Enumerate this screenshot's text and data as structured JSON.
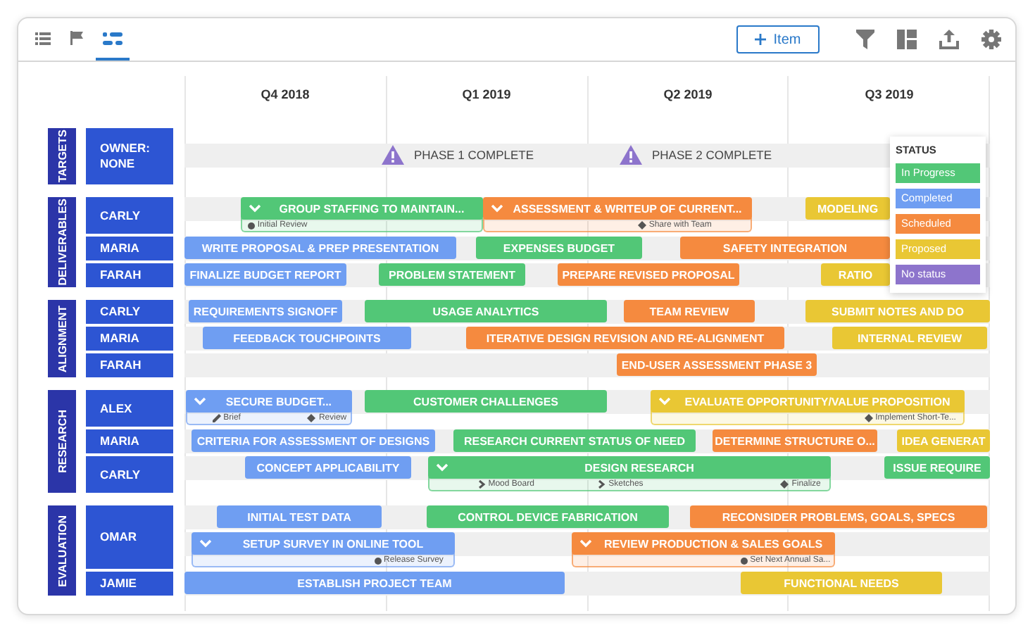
{
  "toolbar": {
    "views": [
      {
        "selected": false
      },
      {
        "selected": false
      },
      {
        "selected": true
      }
    ],
    "add_button": {
      "label": "Item"
    }
  },
  "quarters": [
    "Q4 2018",
    "Q1 2019",
    "Q2 2019",
    "Q3 2019"
  ],
  "legend": {
    "title": "STATUS",
    "items": [
      {
        "label": "In Progress",
        "color": "#52c777"
      },
      {
        "label": "Completed",
        "color": "#6f9ef2"
      },
      {
        "label": "Scheduled",
        "color": "#f58a3f"
      },
      {
        "label": "Proposed",
        "color": "#e9c734"
      },
      {
        "label": "No status",
        "color": "#8d74cc"
      }
    ]
  },
  "groups": [
    {
      "label": "TARGETS",
      "lanes": [
        {
          "owner": "OWNER: NONE",
          "tracks": [
            {
              "milestones": [
                {
                  "label": "PHASE 1 COMPLETE"
                },
                {
                  "label": "PHASE 2 COMPLETE"
                }
              ]
            }
          ]
        }
      ]
    },
    {
      "label": "DELIVERABLES",
      "lanes": [
        {
          "owner": "CARLY",
          "tracks": [
            {
              "bars": [
                {
                  "label": "GROUP STAFFING TO MAINTAIN...",
                  "color": "#52c777",
                  "expanded": true,
                  "subitems": [
                    {
                      "kind": "dot",
                      "label": "Initial Review"
                    }
                  ]
                },
                {
                  "label": "ASSESSMENT & WRITEUP OF CURRENT...",
                  "color": "#f58a3f",
                  "expanded": true,
                  "subitems": [
                    {
                      "kind": "diamond",
                      "label": "Share with Team"
                    }
                  ]
                },
                {
                  "label": "MODELING",
                  "color": "#e9c734",
                  "expanded": false
                }
              ]
            }
          ]
        },
        {
          "owner": "MARIA",
          "tracks": [
            {
              "bars": [
                {
                  "label": "WRITE PROPOSAL & PREP PRESENTATION",
                  "color": "#6f9ef2",
                  "expanded": false
                },
                {
                  "label": "EXPENSES BUDGET",
                  "color": "#52c777",
                  "expanded": false
                },
                {
                  "label": "SAFETY INTEGRATION",
                  "color": "#f58a3f",
                  "expanded": false
                }
              ]
            }
          ]
        },
        {
          "owner": "FARAH",
          "tracks": [
            {
              "bars": [
                {
                  "label": "FINALIZE BUDGET REPORT",
                  "color": "#6f9ef2",
                  "expanded": false
                },
                {
                  "label": "PROBLEM STATEMENT",
                  "color": "#52c777",
                  "expanded": false
                },
                {
                  "label": "PREPARE REVISED PROPOSAL",
                  "color": "#f58a3f",
                  "expanded": false
                },
                {
                  "label": "RATIO",
                  "color": "#e9c734",
                  "expanded": false
                }
              ]
            }
          ]
        }
      ]
    },
    {
      "label": "ALIGNMENT",
      "lanes": [
        {
          "owner": "CARLY",
          "tracks": [
            {
              "bars": [
                {
                  "label": "REQUIREMENTS SIGNOFF",
                  "color": "#6f9ef2",
                  "expanded": false
                },
                {
                  "label": "USAGE ANALYTICS",
                  "color": "#52c777",
                  "expanded": false
                },
                {
                  "label": "TEAM REVIEW",
                  "color": "#f58a3f",
                  "expanded": false
                },
                {
                  "label": "SUBMIT NOTES AND DO",
                  "color": "#e9c734",
                  "expanded": false
                }
              ]
            }
          ]
        },
        {
          "owner": "MARIA",
          "tracks": [
            {
              "bars": [
                {
                  "label": "FEEDBACK TOUCHPOINTS",
                  "color": "#6f9ef2",
                  "expanded": false
                },
                {
                  "label": "ITERATIVE DESIGN REVISION AND RE-ALIGNMENT",
                  "color": "#f58a3f",
                  "expanded": false
                },
                {
                  "label": "INTERNAL REVIEW",
                  "color": "#e9c734",
                  "expanded": false
                }
              ]
            }
          ]
        },
        {
          "owner": "FARAH",
          "tracks": [
            {
              "bars": [
                {
                  "label": "END-USER ASSESSMENT PHASE 3",
                  "color": "#f58a3f",
                  "expanded": false
                }
              ]
            }
          ]
        }
      ]
    },
    {
      "label": "RESEARCH",
      "lanes": [
        {
          "owner": "ALEX",
          "tracks": [
            {
              "bars": [
                {
                  "label": "SECURE BUDGET...",
                  "color": "#6f9ef2",
                  "expanded": true,
                  "subitems": [
                    {
                      "kind": "pencil",
                      "label": "Brief"
                    },
                    {
                      "kind": "diamond",
                      "label": "Review"
                    }
                  ]
                },
                {
                  "label": "CUSTOMER CHALLENGES",
                  "color": "#52c777",
                  "expanded": false
                },
                {
                  "label": "EVALUATE OPPORTUNITY/VALUE PROPOSITION",
                  "color": "#e9c734",
                  "expanded": true,
                  "subitems": [
                    {
                      "kind": "diamond",
                      "label": "Implement Short-Te..."
                    }
                  ]
                }
              ]
            }
          ]
        },
        {
          "owner": "MARIA",
          "tracks": [
            {
              "bars": [
                {
                  "label": "CRITERIA FOR ASSESSMENT OF DESIGNS",
                  "color": "#6f9ef2",
                  "expanded": false
                },
                {
                  "label": "RESEARCH CURRENT STATUS OF NEED",
                  "color": "#52c777",
                  "expanded": false
                },
                {
                  "label": "DETERMINE STRUCTURE O...",
                  "color": "#f58a3f",
                  "expanded": false
                },
                {
                  "label": "IDEA GENERAT",
                  "color": "#e9c734",
                  "expanded": false
                }
              ]
            }
          ]
        },
        {
          "owner": "CARLY",
          "tracks": [
            {
              "bars": [
                {
                  "label": "CONCEPT APPLICABILITY",
                  "color": "#6f9ef2",
                  "expanded": false
                },
                {
                  "label": "DESIGN RESEARCH",
                  "color": "#52c777",
                  "expanded": true,
                  "subitems": [
                    {
                      "kind": "chevron",
                      "label": "Mood Board"
                    },
                    {
                      "kind": "chevron",
                      "label": "Sketches"
                    },
                    {
                      "kind": "diamond",
                      "label": "Finalize"
                    }
                  ]
                },
                {
                  "label": "ISSUE REQUIRE",
                  "color": "#52c777",
                  "expanded": false
                }
              ]
            }
          ]
        }
      ]
    },
    {
      "label": "EVALUATION",
      "lanes": [
        {
          "owner": "OMAR",
          "tracks": [
            {
              "bars": [
                {
                  "label": "INITIAL TEST DATA",
                  "color": "#6f9ef2",
                  "expanded": false
                },
                {
                  "label": "CONTROL DEVICE FABRICATION",
                  "color": "#52c777",
                  "expanded": false
                },
                {
                  "label": "RECONSIDER PROBLEMS, GOALS, SPECS",
                  "color": "#f58a3f",
                  "expanded": false
                }
              ]
            },
            {
              "bars": [
                {
                  "label": "SETUP SURVEY IN ONLINE TOOL",
                  "color": "#6f9ef2",
                  "expanded": true,
                  "subitems": [
                    {
                      "kind": "dot",
                      "label": "Release Survey"
                    }
                  ]
                },
                {
                  "label": "REVIEW PRODUCTION & SALES GOALS",
                  "color": "#f58a3f",
                  "expanded": true,
                  "subitems": [
                    {
                      "kind": "dot",
                      "label": "Set Next Annual Sa..."
                    }
                  ]
                }
              ]
            }
          ]
        },
        {
          "owner": "JAMIE",
          "tracks": [
            {
              "bars": [
                {
                  "label": "ESTABLISH PROJECT TEAM",
                  "color": "#6f9ef2",
                  "expanded": false
                },
                {
                  "label": "FUNCTIONAL NEEDS",
                  "color": "#e9c734",
                  "expanded": false
                }
              ]
            }
          ]
        }
      ]
    }
  ]
}
